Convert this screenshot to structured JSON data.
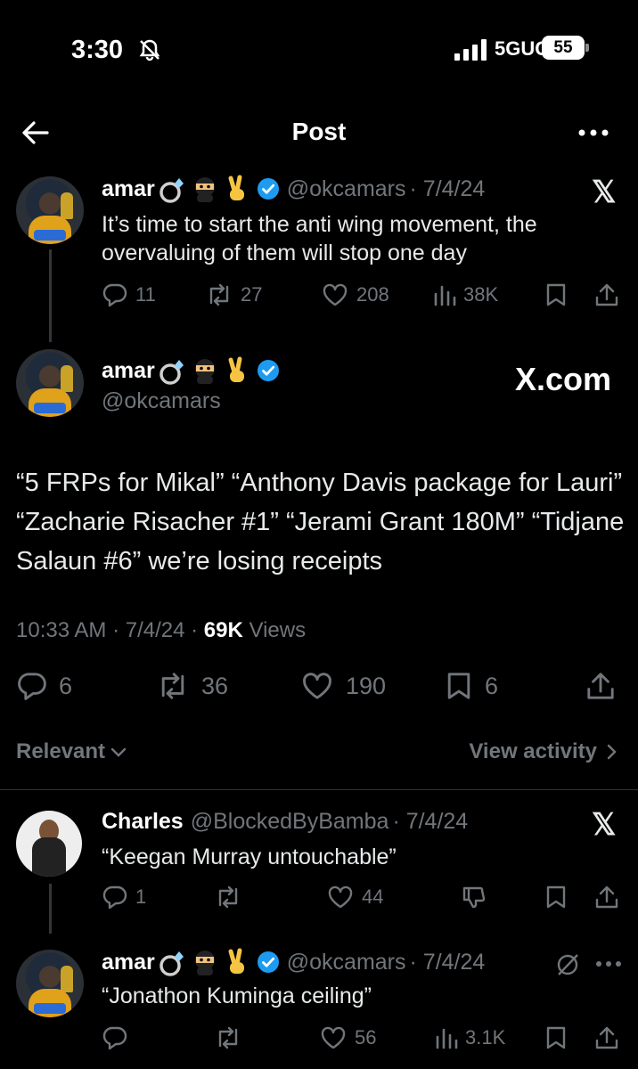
{
  "status_bar": {
    "time": "3:30",
    "network": "5GUC",
    "battery": "55"
  },
  "header": {
    "title": "Post"
  },
  "parent_post": {
    "name": "amar",
    "handle": "@okcamars",
    "date": "· 7/4/24",
    "text": "It’s time to start the anti wing movement, the overvaluing of them will stop one day",
    "replies": "11",
    "reposts": "27",
    "likes": "208",
    "views": "38K"
  },
  "main_post": {
    "name": "amar",
    "handle": "@okcamars",
    "badge": "X.com",
    "text": "“5 FRPs for Mikal” “Anthony Davis package for Lauri” “Zacharie Risacher #1” “Jerami Grant 180M” “Tidjane Salaun #6” we’re losing receipts",
    "time": "10:33 AM · 7/4/24 ·",
    "views_count": "69K",
    "views_label": "Views",
    "replies": "6",
    "reposts": "36",
    "likes": "190",
    "bookmarks": "6"
  },
  "sort": {
    "label": "Relevant",
    "view_activity": "View activity"
  },
  "replies": [
    {
      "name": "Charles",
      "handle": "@BlockedByBamba",
      "date": "· 7/4/24",
      "text": "“Keegan Murray untouchable”",
      "replies": "1",
      "reposts": "",
      "likes": "44"
    },
    {
      "name": "amar",
      "handle": "@okcamars",
      "date": "· 7/4/24",
      "text": "“Jonathon Kuminga ceiling”",
      "replies": "",
      "reposts": "",
      "likes": "56",
      "views": "3.1K"
    }
  ],
  "colors": {
    "background": "#000000",
    "muted": "#71767b",
    "verified": "#1d9bf0"
  },
  "icons": [
    "back-arrow-icon",
    "more-icon",
    "x-logo-icon",
    "verified-icon",
    "reply-icon",
    "repost-icon",
    "like-icon",
    "views-icon",
    "bookmark-icon",
    "share-icon",
    "dislike-icon",
    "grok-icon",
    "chevron-down-icon",
    "chevron-right-icon"
  ]
}
